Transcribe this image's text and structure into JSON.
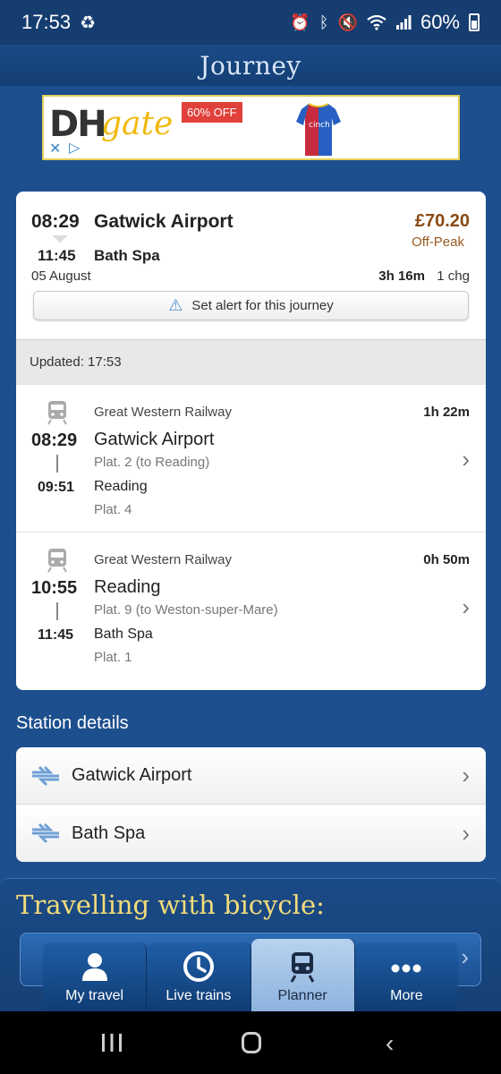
{
  "status_bar": {
    "time": "17:53",
    "battery": "60%"
  },
  "header": {
    "title": "Journey"
  },
  "ad": {
    "logo_dh": "DH",
    "logo_gate": "gate",
    "badge": "60% OFF",
    "shirt_text": "cinch",
    "close_icon": "✕",
    "play_icon": "▷"
  },
  "journey": {
    "departure_time": "08:29",
    "departure_station": "Gatwick Airport",
    "arrival_time": "11:45",
    "arrival_station": "Bath Spa",
    "price": "£70.20",
    "fare_type": "Off-Peak",
    "date": "05 August",
    "duration": "3h 16m",
    "changes": "1 chg",
    "alert_label": "Set alert for this journey",
    "updated": "Updated: 17:53"
  },
  "legs": [
    {
      "operator": "Great Western Railway",
      "duration": "1h 22m",
      "dep_time": "08:29",
      "dep_station": "Gatwick Airport",
      "dep_platform": "Plat. 2 (to Reading)",
      "arr_time": "09:51",
      "arr_station": "Reading",
      "arr_platform": "Plat. 4"
    },
    {
      "operator": "Great Western Railway",
      "duration": "0h 50m",
      "dep_time": "10:55",
      "dep_station": "Reading",
      "dep_platform": "Plat. 9 (to Weston-super-Mare)",
      "arr_time": "11:45",
      "arr_station": "Bath Spa",
      "arr_platform": "Plat. 1"
    }
  ],
  "station_details": {
    "title": "Station details",
    "stations": [
      "Gatwick Airport",
      "Bath Spa"
    ]
  },
  "bicycle": {
    "title": "Travelling with bicycle:"
  },
  "tabs": [
    {
      "label": "My travel",
      "icon": "person-icon"
    },
    {
      "label": "Live trains",
      "icon": "clock-icon"
    },
    {
      "label": "Planner",
      "icon": "train-icon",
      "active": true
    },
    {
      "label": "More",
      "icon": "more-icon"
    }
  ],
  "colors": {
    "background": "#1d4f8e",
    "price": "#8a4a14",
    "bike_title": "#f3dc7a",
    "active_tab": "#a9c7ea"
  }
}
